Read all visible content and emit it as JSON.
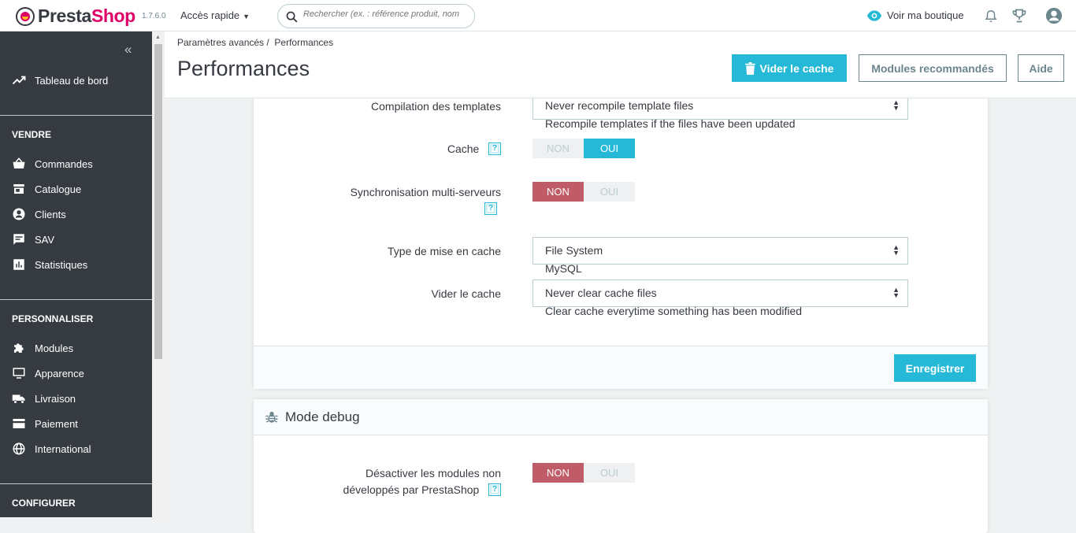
{
  "header": {
    "brand_prefix": "Presta",
    "brand_suffix": "Shop",
    "version": "1.7.6.0",
    "quick_access": "Accès rapide",
    "search_placeholder": "Rechercher (ex. : référence produit, nom",
    "view_shop": "Voir ma boutique"
  },
  "sidebar": {
    "collapse": "«",
    "dashboard": "Tableau de bord",
    "sections": [
      {
        "title": "VENDRE",
        "items": [
          "Commandes",
          "Catalogue",
          "Clients",
          "SAV",
          "Statistiques"
        ]
      },
      {
        "title": "PERSONNALISER",
        "items": [
          "Modules",
          "Apparence",
          "Livraison",
          "Paiement",
          "International"
        ]
      },
      {
        "title": "CONFIGURER"
      }
    ]
  },
  "page": {
    "breadcrumb": [
      "Paramètres avancés",
      "Performances"
    ],
    "title": "Performances",
    "buttons": {
      "clear_cache": "Vider le cache",
      "recommended": "Modules recommandés",
      "help": "Aide"
    }
  },
  "form": {
    "compilation": {
      "label": "Compilation des templates",
      "value": "Never recompile template files",
      "option_below": "Recompile templates if the files have been updated"
    },
    "cache": {
      "label": "Cache",
      "off": "NON",
      "on": "OUI",
      "state": "OUI"
    },
    "sync": {
      "label": "Synchronisation multi-serveurs",
      "off": "NON",
      "on": "OUI",
      "state": "NON"
    },
    "cache_type": {
      "label": "Type de mise en cache",
      "value": "File System",
      "option_below": "MySQL"
    },
    "clear_cache": {
      "label": "Vider le cache",
      "value": "Never clear cache files",
      "option_below": "Clear cache everytime something has been modified"
    },
    "save": "Enregistrer"
  },
  "debug": {
    "title": "Mode debug",
    "disable_modules": {
      "label_line1": "Désactiver les modules non",
      "label_line2": "développés par PrestaShop",
      "off": "NON",
      "on": "OUI",
      "state": "NON"
    }
  },
  "help_glyph": "?",
  "colors": {
    "primary": "#25b9d7",
    "danger": "#c05c67",
    "sidebar": "#363a41",
    "brand": "#df0067"
  }
}
